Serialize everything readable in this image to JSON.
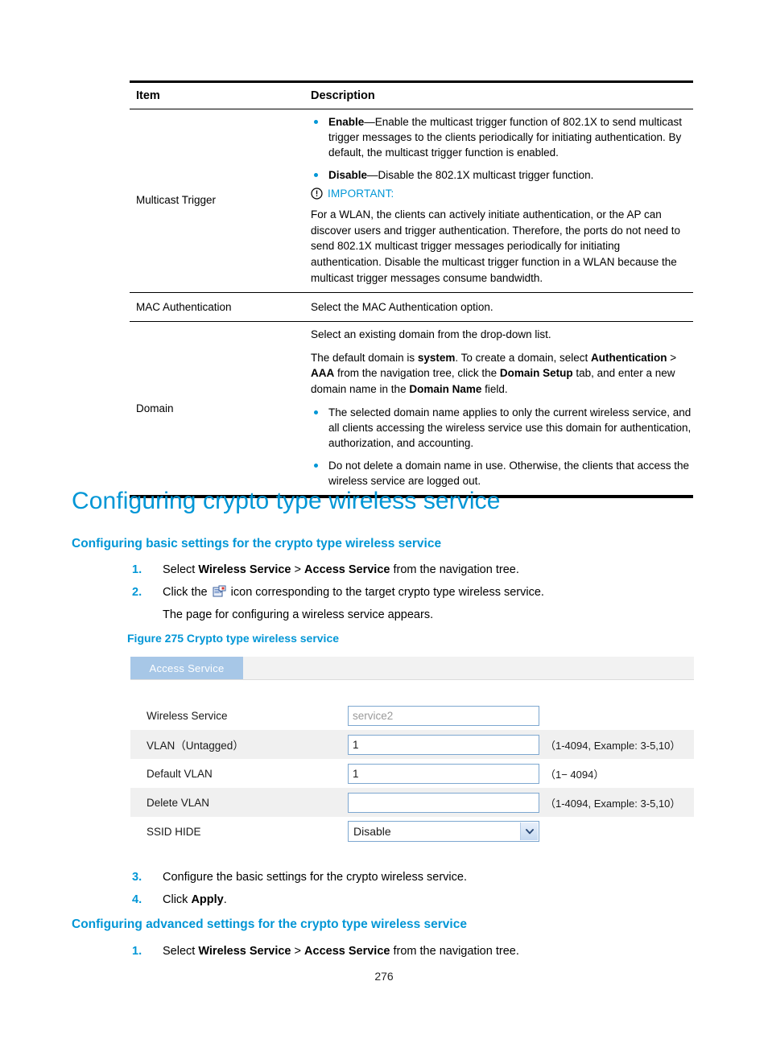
{
  "table": {
    "headers": {
      "item": "Item",
      "description": "Description"
    },
    "rows": [
      {
        "item": "Multicast Trigger",
        "bullets": [
          {
            "term": "Enable",
            "dash": "—",
            "text": "Enable the multicast trigger function of 802.1X to send multicast trigger messages to the clients periodically for initiating authentication. By default, the multicast trigger function is enabled."
          },
          {
            "term": "Disable",
            "dash": "—",
            "text": "Disable the 802.1X multicast trigger function."
          }
        ],
        "note": {
          "icon": "important-icon",
          "label": "IMPORTANT:",
          "text": "For a WLAN, the clients can actively initiate authentication, or the AP can discover users and trigger authentication. Therefore, the ports do not need to send 802.1X multicast trigger messages periodically for initiating authentication. Disable the multicast trigger function in a WLAN because the multicast trigger messages consume bandwidth."
        }
      },
      {
        "item": "MAC Authentication",
        "text": "Select the MAC Authentication option."
      },
      {
        "item": "Domain",
        "paragraphs": [
          "Select an existing domain from the drop-down list."
        ],
        "rich_paragraph": {
          "p1": "The default domain is ",
          "b1": "system",
          "p2": ". To create a domain, select ",
          "b2": "Authentication",
          "p3": " > ",
          "b3": "AAA",
          "p4": " from the navigation tree, click the ",
          "b4": "Domain Setup",
          "p5": " tab, and enter a new domain name in the ",
          "b5": "Domain Name",
          "p6": " field."
        },
        "bullets_plain": [
          "The selected domain name applies to only the current wireless service, and all clients accessing the wireless service use this domain for authentication, authorization, and accounting.",
          "Do not delete a domain name in use. Otherwise, the clients that access the wireless service are logged out."
        ]
      }
    ]
  },
  "section": {
    "h1": "Configuring crypto type wireless service",
    "basic_heading": "Configuring basic settings for the crypto type wireless service",
    "advanced_heading": "Configuring advanced settings for the crypto type wireless service"
  },
  "steps_basic": {
    "step1": {
      "num": "1.",
      "pre": "Select ",
      "b1": "Wireless Service",
      "mid": " > ",
      "b2": "Access Service",
      "post": " from the navigation tree."
    },
    "step2": {
      "num": "2.",
      "pre": "Click the ",
      "icon": "wireless-service-icon",
      "post": " icon corresponding to the target crypto type wireless service."
    },
    "step2_sub": "The page for configuring a wireless service appears."
  },
  "steps_after_figure": {
    "step3": {
      "num": "3.",
      "text": "Configure the basic settings for the crypto wireless service."
    },
    "step4": {
      "num": "4.",
      "pre": "Click ",
      "b1": "Apply",
      "post": "."
    }
  },
  "steps_advanced": {
    "step1": {
      "num": "1.",
      "pre": "Select ",
      "b1": "Wireless Service",
      "mid": " > ",
      "b2": "Access Service",
      "post": " from the navigation tree."
    }
  },
  "figure": {
    "caption": "Figure 275 Crypto type wireless service",
    "tab_label": "Access Service",
    "rows": [
      {
        "label": "Wireless Service",
        "control": "text",
        "value": "service2",
        "readonly": true,
        "hint": ""
      },
      {
        "label": "VLAN（Untagged）",
        "control": "text",
        "value": "1",
        "readonly": false,
        "hint": "（1-4094, Example: 3-5,10）"
      },
      {
        "label": "Default VLAN",
        "control": "text",
        "value": "1",
        "readonly": false,
        "hint": "（1− 4094）"
      },
      {
        "label": "Delete VLAN",
        "control": "text",
        "value": "",
        "readonly": false,
        "hint": "（1-4094, Example: 3-5,10）"
      },
      {
        "label": "SSID HIDE",
        "control": "select",
        "value": "Disable",
        "readonly": false,
        "hint": ""
      }
    ]
  },
  "page_number": "276",
  "colors": {
    "accent_blue": "#0096d6",
    "tab_blue": "#a7c7e7",
    "field_border": "#7da7d0",
    "row_alt": "#f0f0f0"
  }
}
